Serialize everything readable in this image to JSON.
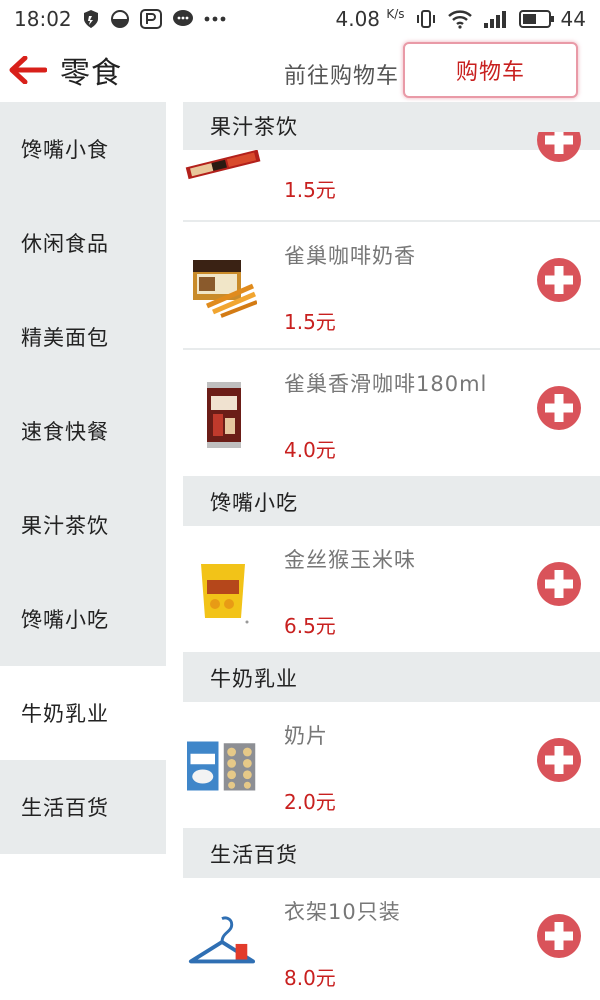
{
  "status": {
    "time": "18:02",
    "net_speed": "4.08",
    "net_unit": "K/s",
    "battery": "44"
  },
  "header": {
    "title": "零食",
    "goto_cart": "前往购物车",
    "cart": "购物车"
  },
  "sidebar": {
    "items": [
      {
        "label": "馋嘴小食"
      },
      {
        "label": "休闲食品"
      },
      {
        "label": "精美面包"
      },
      {
        "label": "速食快餐"
      },
      {
        "label": "果汁茶饮"
      },
      {
        "label": "馋嘴小吃"
      },
      {
        "label": "牛奶乳业"
      },
      {
        "label": "生活百货"
      }
    ]
  },
  "content": {
    "sections": [
      {
        "title": "果汁茶饮",
        "products": [
          {
            "name": "",
            "price": "1.5元",
            "icon": "nescafe-sticks-icon"
          },
          {
            "name": "雀巢咖啡奶香",
            "price": "1.5元",
            "icon": "nescafe-box-icon"
          },
          {
            "name": "雀巢香滑咖啡180ml",
            "price": "4.0元",
            "icon": "coffee-can-icon"
          }
        ]
      },
      {
        "title": "馋嘴小吃",
        "products": [
          {
            "name": "金丝猴玉米味",
            "price": "6.5元",
            "icon": "candy-bag-icon"
          }
        ]
      },
      {
        "title": "牛奶乳业",
        "products": [
          {
            "name": "奶片",
            "price": "2.0元",
            "icon": "milk-tablets-icon"
          }
        ]
      },
      {
        "title": "生活百货",
        "products": [
          {
            "name": "衣架10只装",
            "price": "8.0元",
            "icon": "hanger-icon"
          }
        ]
      }
    ]
  },
  "colors": {
    "accent": "#c8201f",
    "add_button": "#d9535a",
    "sidebar_bg": "#e8ebec"
  }
}
